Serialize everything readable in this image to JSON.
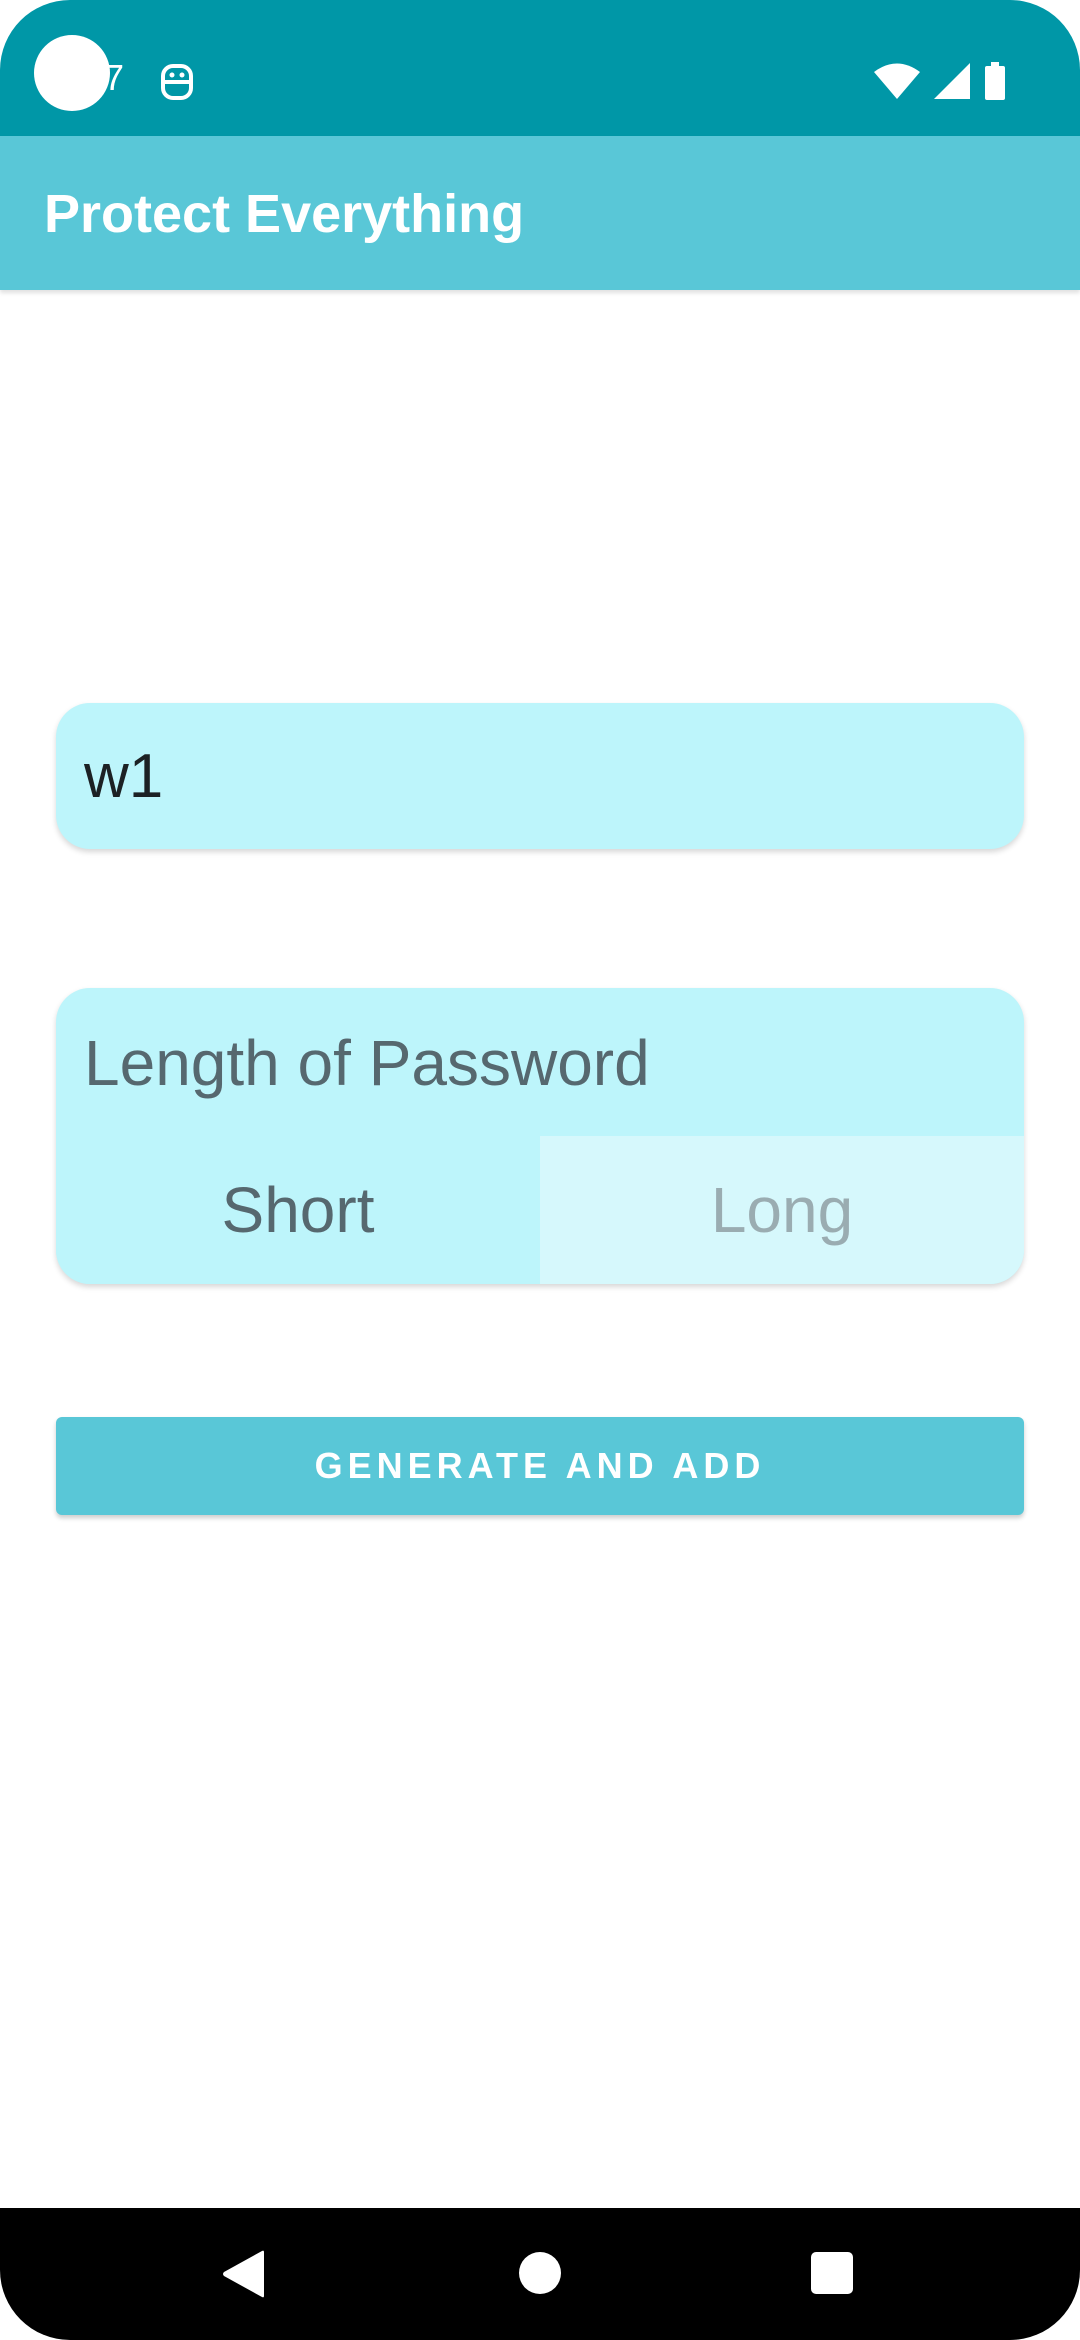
{
  "status_bar": {
    "time": "7",
    "icons": [
      "camera-cutout",
      "notification-icon",
      "wifi-icon",
      "signal-icon",
      "battery-icon"
    ],
    "color": "#0097a7"
  },
  "app_bar": {
    "title": "Protect Everything",
    "color": "#59c7d7"
  },
  "name_field": {
    "value": "w1",
    "background": "#bdf5fb"
  },
  "length_selector": {
    "label": "Length of Password",
    "options": [
      {
        "label": "Short",
        "selected": true
      },
      {
        "label": "Long",
        "selected": false
      }
    ]
  },
  "generate_button": {
    "label": "GENERATE AND ADD",
    "color": "#59c7d7"
  },
  "nav_bar": {
    "icons": [
      "back-icon",
      "home-icon",
      "recents-icon"
    ]
  }
}
